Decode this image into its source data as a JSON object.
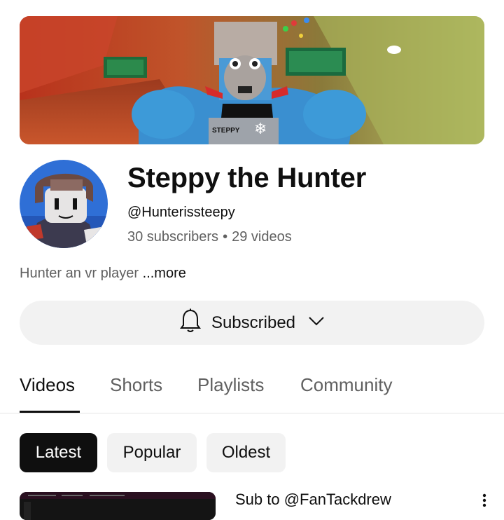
{
  "channel": {
    "name": "Steppy the Hunter",
    "handle": "@Hunterissteepy",
    "subscribers": "30 subscribers",
    "separator": "•",
    "videos": "29 videos",
    "description": "Hunter an vr player",
    "more_label": "...more",
    "banner_text": "STEPPY"
  },
  "subscribe": {
    "label": "Subscribed",
    "bell_icon": "bell-icon",
    "chevron_icon": "chevron-down-icon"
  },
  "tabs": [
    {
      "label": "Videos",
      "active": true
    },
    {
      "label": "Shorts",
      "active": false
    },
    {
      "label": "Playlists",
      "active": false
    },
    {
      "label": "Community",
      "active": false
    }
  ],
  "filters": [
    {
      "label": "Latest",
      "active": true
    },
    {
      "label": "Popular",
      "active": false
    },
    {
      "label": "Oldest",
      "active": false
    }
  ],
  "videos": [
    {
      "title": "Sub to @FanTackdrew"
    }
  ],
  "colors": {
    "text_primary": "#0f0f0f",
    "text_secondary": "#606060",
    "chip_bg": "#f2f2f2",
    "chip_active_bg": "#0f0f0f"
  }
}
